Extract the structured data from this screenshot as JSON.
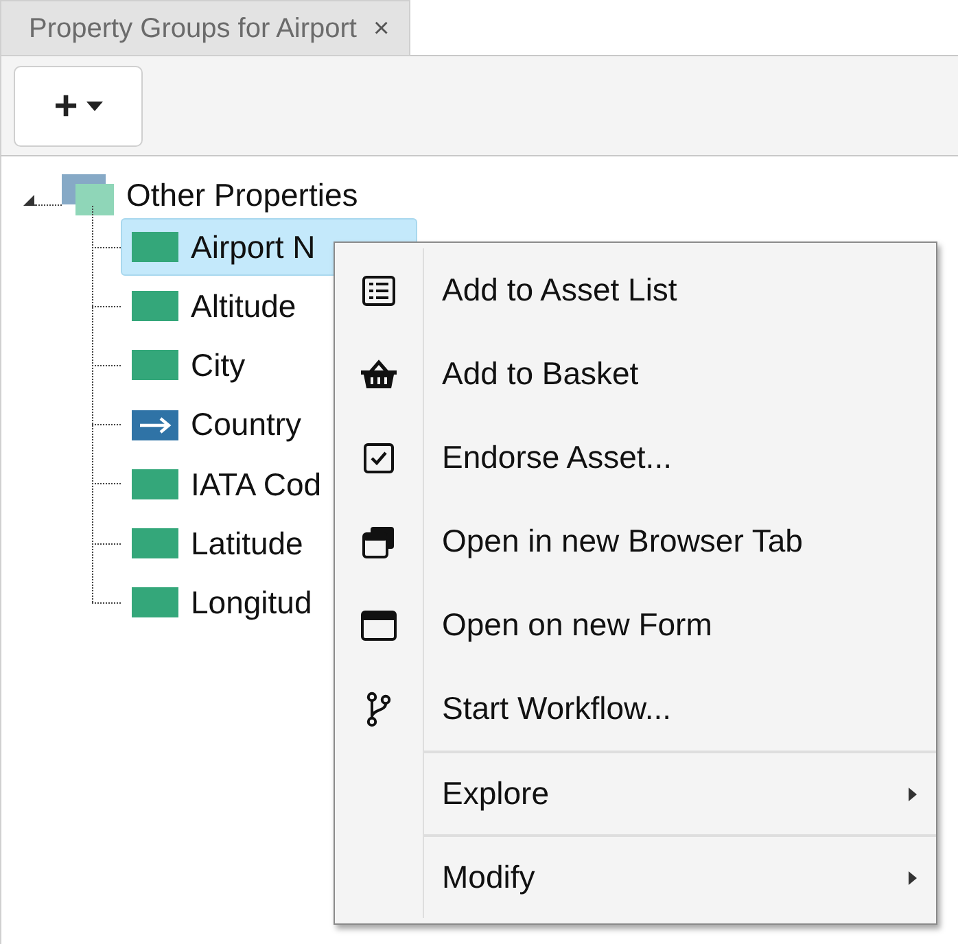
{
  "tab": {
    "label": "Property Groups for Airport",
    "close": "×",
    "selected": true
  },
  "toolbar": {
    "add_button": "+"
  },
  "tree": {
    "label": "Other Properties",
    "expanded": true,
    "children": [
      {
        "label": "Airport N",
        "kind": "field",
        "selected": true
      },
      {
        "label": "Altitude",
        "kind": "field",
        "selected": false
      },
      {
        "label": "City",
        "kind": "field",
        "selected": false
      },
      {
        "label": "Country",
        "kind": "link",
        "selected": false
      },
      {
        "label": "IATA Cod",
        "kind": "field",
        "selected": false
      },
      {
        "label": "Latitude",
        "kind": "field",
        "selected": false
      },
      {
        "label": "Longitud",
        "kind": "field",
        "selected": false
      }
    ]
  },
  "context_menu": {
    "groups": [
      [
        {
          "label": "Add to Asset List",
          "kind": "action"
        },
        {
          "label": "Add to Basket",
          "kind": "action"
        },
        {
          "label": "Endorse Asset...",
          "kind": "action"
        },
        {
          "label": "Open in new Browser Tab",
          "kind": "action"
        },
        {
          "label": "Open on new Form",
          "kind": "action"
        },
        {
          "label": "Start Workflow...",
          "kind": "action"
        }
      ],
      [
        {
          "label": "Explore",
          "kind": "submenu"
        }
      ],
      [
        {
          "label": "Modify",
          "kind": "submenu"
        }
      ]
    ]
  }
}
